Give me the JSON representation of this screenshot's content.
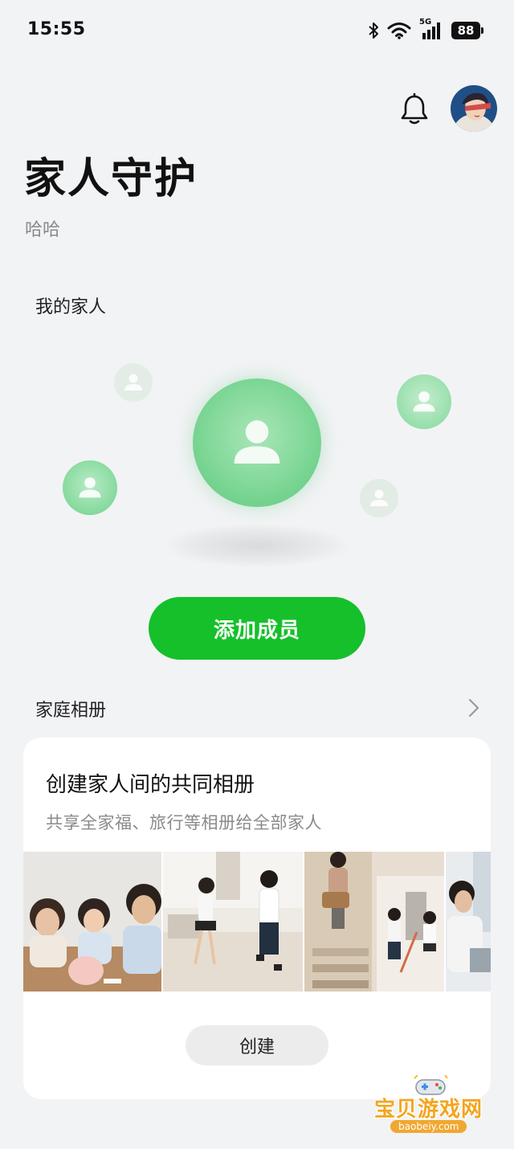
{
  "status_bar": {
    "time": "15:55",
    "network": "5G",
    "battery": "88"
  },
  "header": {
    "title": "家人守护",
    "subtitle": "哈哈",
    "bell_icon": "bell-icon",
    "avatar_icon": "user-avatar"
  },
  "family": {
    "section_title": "我的家人",
    "add_member_label": "添加成员",
    "colors": {
      "accent": "#15c02a",
      "bubble": "#7fd797"
    }
  },
  "album": {
    "section_title": "家庭相册",
    "card_title": "创建家人间的共同相册",
    "card_desc": "共享全家福、旅行等相册给全部家人",
    "photos": [
      "family-photo-piggybank",
      "family-photo-playing",
      "family-photo-stairs",
      "family-photo-laptop"
    ],
    "create_label": "创建"
  },
  "watermark": {
    "text": "宝贝游戏网",
    "url": "baobeiy.com"
  }
}
